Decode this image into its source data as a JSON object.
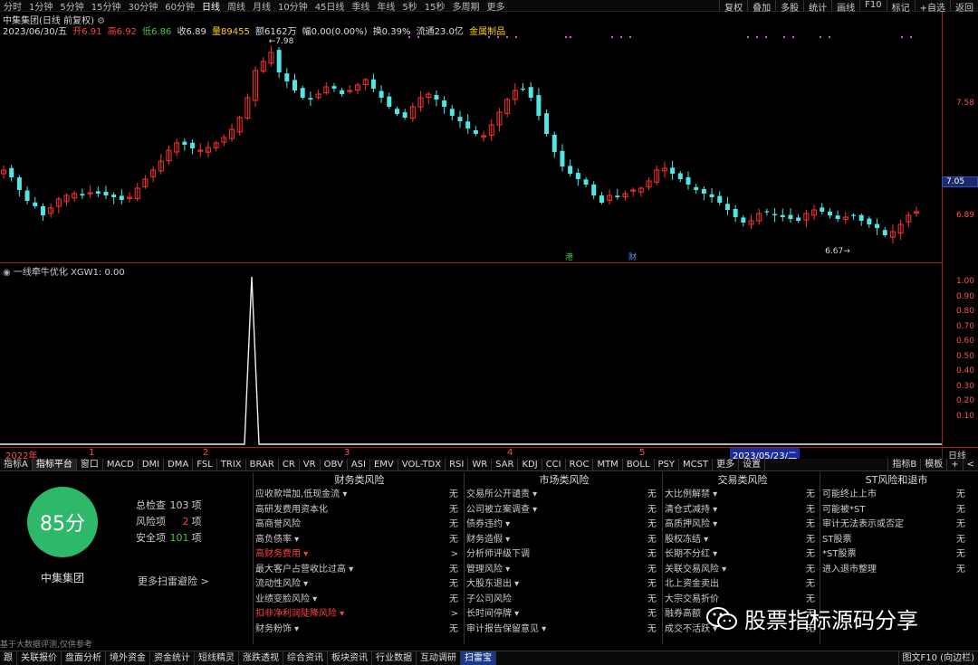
{
  "topbar": {
    "timeframes": [
      "分时",
      "1分钟",
      "5分钟",
      "15分钟",
      "30分钟",
      "60分钟",
      "日线",
      "周线",
      "月线",
      "10分钟",
      "45日线",
      "季线",
      "年线",
      "5秒",
      "15秒",
      "多周期",
      "更多"
    ],
    "active": "日线",
    "right_buttons": [
      "复权",
      "叠加",
      "多股",
      "统计",
      "画线",
      "F10",
      "标记",
      "+自选",
      "返回"
    ]
  },
  "header": {
    "title": "中集集团(日线 前复权)",
    "date": "2023/06/30/五",
    "open_label": "开6.91",
    "high_label": "高6.92",
    "low_label": "低6.86",
    "close_label": "收6.89",
    "volume_label": "量89455",
    "amount_label": "额6162万",
    "change_label": "幅0.00(0.00%)",
    "turnover_label": "换0.39%",
    "float_label": "流通23.0亿",
    "sector_label": "金属制品"
  },
  "price_axis": {
    "ticks": [
      "7.58",
      "6.89"
    ],
    "current": "7.05",
    "high_mark": "7.98",
    "low_mark": "6.67"
  },
  "indicator": {
    "title": "一线牵牛优化 XGW1: 0.00",
    "ticks": [
      "1.00",
      "0.90",
      "0.80",
      "0.70",
      "0.60",
      "0.50",
      "0.40",
      "0.30",
      "0.20",
      "0.10"
    ]
  },
  "markers": {
    "gang": "港",
    "cai": "财"
  },
  "timeline": {
    "labels": [
      "2022年",
      "1",
      "2",
      "3",
      "4",
      "5"
    ],
    "cursor_date": "2023/05/23/二",
    "right_label": "日线"
  },
  "tabbar": {
    "tabs": [
      "指标A",
      "指标平台",
      "窗口",
      "MACD",
      "DMI",
      "DMA",
      "FSL",
      "TRIX",
      "BRAR",
      "CR",
      "VR",
      "OBV",
      "ASI",
      "EMV",
      "VOL-TDX",
      "RSI",
      "WR",
      "SAR",
      "KDJ",
      "CCI",
      "ROC",
      "MTM",
      "BOLL",
      "PSY",
      "MCST",
      "更多",
      "设置"
    ],
    "selected": "指标平台",
    "right": [
      "指标B",
      "模板",
      "+",
      "<"
    ]
  },
  "score": {
    "value": "85分",
    "name": "中集集团",
    "total_label": "总检查",
    "total_value": "103",
    "total_unit": "项",
    "risk_label": "风险项",
    "risk_value": "2",
    "risk_unit": "项",
    "safe_label": "安全项",
    "safe_value": "101",
    "safe_unit": "项",
    "more_scan": "更多扫雷避险 >",
    "disclaimer": "基于大数据评测,仅供参考"
  },
  "risk_columns": [
    {
      "title": "财务类风险",
      "items": [
        {
          "name": "应收款增加,低现金流 ▾",
          "status": "无",
          "red": false
        },
        {
          "name": "高研发费用资本化",
          "status": "无",
          "red": false
        },
        {
          "name": "高商誉风险",
          "status": "无",
          "red": false
        },
        {
          "name": "高负债率 ▾",
          "status": "无",
          "red": false
        },
        {
          "name": "高财务费用 ▾",
          "status": ">",
          "red": true
        },
        {
          "name": "最大客户占营收比过高 ▾",
          "status": "无",
          "red": false
        },
        {
          "name": "流动性风险 ▾",
          "status": "无",
          "red": false
        },
        {
          "name": "业绩变脸风险 ▾",
          "status": "无",
          "red": false
        },
        {
          "name": "扣非净利润陡降风险 ▾",
          "status": ">",
          "red": true
        },
        {
          "name": "财务粉饰 ▾",
          "status": "无",
          "red": false
        }
      ]
    },
    {
      "title": "市场类风险",
      "items": [
        {
          "name": "交易所公开谴责 ▾",
          "status": "无",
          "red": false
        },
        {
          "name": "公司被立案调查 ▾",
          "status": "无",
          "red": false
        },
        {
          "name": "债券违约 ▾",
          "status": "无",
          "red": false
        },
        {
          "name": "财务造假 ▾",
          "status": "无",
          "red": false
        },
        {
          "name": "分析师评级下调",
          "status": "无",
          "red": false
        },
        {
          "name": "管理风险 ▾",
          "status": "无",
          "red": false
        },
        {
          "name": "大股东退出 ▾",
          "status": "无",
          "red": false
        },
        {
          "name": "子公司风险",
          "status": "无",
          "red": false
        },
        {
          "name": "长时间停牌 ▾",
          "status": "无",
          "red": false
        },
        {
          "name": "审计报告保留意见 ▾",
          "status": "无",
          "red": false
        }
      ]
    },
    {
      "title": "交易类风险",
      "items": [
        {
          "name": "大比例解禁 ▾",
          "status": "无",
          "red": false
        },
        {
          "name": "清仓式减持 ▾",
          "status": "无",
          "red": false
        },
        {
          "name": "高质押风险 ▾",
          "status": "无",
          "red": false
        },
        {
          "name": "股权冻结 ▾",
          "status": "无",
          "red": false
        },
        {
          "name": "长期不分红 ▾",
          "status": "无",
          "red": false
        },
        {
          "name": "关联交易风险 ▾",
          "status": "无",
          "red": false
        },
        {
          "name": "北上资金卖出",
          "status": "无",
          "red": false
        },
        {
          "name": "大宗交易折价",
          "status": "无",
          "red": false
        },
        {
          "name": "融券高额",
          "status": "无",
          "red": false
        },
        {
          "name": "成交不活跃 ▾",
          "status": "无",
          "red": false
        }
      ]
    },
    {
      "title": "ST风险和退市",
      "items": [
        {
          "name": "可能终止上市",
          "status": "无",
          "red": false
        },
        {
          "name": "可能被*ST",
          "status": "无",
          "red": false
        },
        {
          "name": "审计无法表示或否定",
          "status": "无",
          "red": false
        },
        {
          "name": "ST股票",
          "status": "无",
          "red": false
        },
        {
          "name": "*ST股票",
          "status": "无",
          "red": false
        },
        {
          "name": "进入退市整理",
          "status": "无",
          "red": false
        }
      ]
    }
  ],
  "bottombar": {
    "tabs": [
      "跟",
      "关联报价",
      "盘面分析",
      "境外资金",
      "资金统计",
      "短线精灵",
      "涨跌透视",
      "综合资讯",
      "板块资讯",
      "行业数据",
      "互动调研",
      "扫雷宝"
    ],
    "selected": "扫雷宝",
    "right": "图文F10 (向边栏)"
  },
  "watermark": {
    "text": "股票指标源码分享"
  },
  "colors": {
    "up": "#ff3030",
    "down": "#52e5e5",
    "border": "#a02020",
    "score": "#2db86a"
  }
}
